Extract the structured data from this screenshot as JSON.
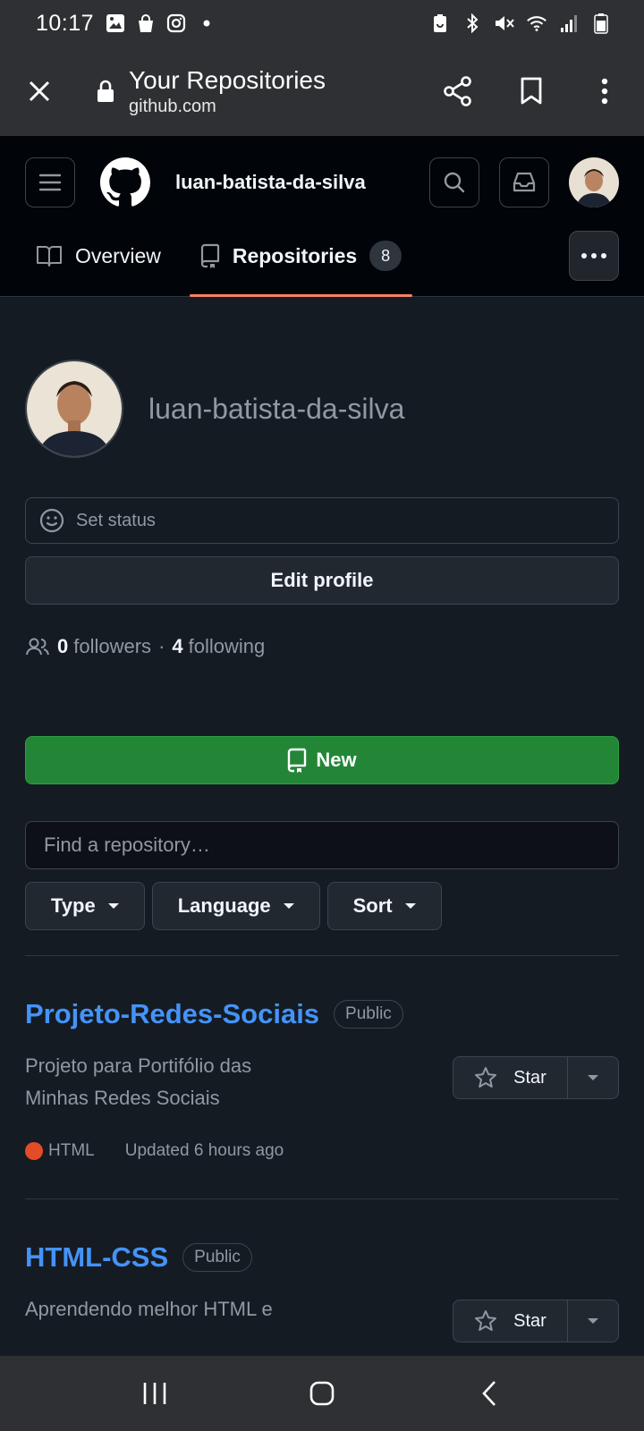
{
  "status_bar": {
    "time": "10:17",
    "left_icons": [
      "gallery-icon",
      "shopping-bag-icon",
      "instagram-icon",
      "dot-icon"
    ],
    "right_icons": [
      "battery-saver-icon",
      "bluetooth-icon",
      "mute-icon",
      "wifi-icon",
      "signal-icon",
      "battery-icon"
    ]
  },
  "browser": {
    "title": "Your Repositories",
    "url": "github.com",
    "actions": [
      "share-icon",
      "bookmark-icon",
      "more-vertical-icon"
    ]
  },
  "header": {
    "username": "luan-batista-da-silva",
    "tabs": [
      {
        "label": "Overview",
        "icon": "book-icon"
      },
      {
        "label": "Repositories",
        "icon": "repo-icon",
        "count": "8",
        "active": true
      }
    ]
  },
  "profile": {
    "name": "luan-batista-da-silva",
    "status_label": "Set status",
    "edit_label": "Edit profile",
    "followers_count": "0",
    "followers_label": "followers",
    "separator": "·",
    "following_count": "4",
    "following_label": "following"
  },
  "repos_toolbar": {
    "new_label": "New",
    "search_placeholder": "Find a repository…",
    "filters": [
      "Type",
      "Language",
      "Sort"
    ]
  },
  "repositories": [
    {
      "name": "Projeto-Redes-Sociais",
      "visibility": "Public",
      "description": "Projeto para Portifólio das Minhas Redes Sociais",
      "language": "HTML",
      "language_color": "#e34c26",
      "updated": "Updated 6 hours ago",
      "star_label": "Star"
    },
    {
      "name": "HTML-CSS",
      "visibility": "Public",
      "description": "Aprendendo melhor HTML e",
      "star_label": "Star"
    }
  ],
  "colors": {
    "accent_link": "#4493f8",
    "new_button": "#238636",
    "tab_underline": "#f78166"
  }
}
